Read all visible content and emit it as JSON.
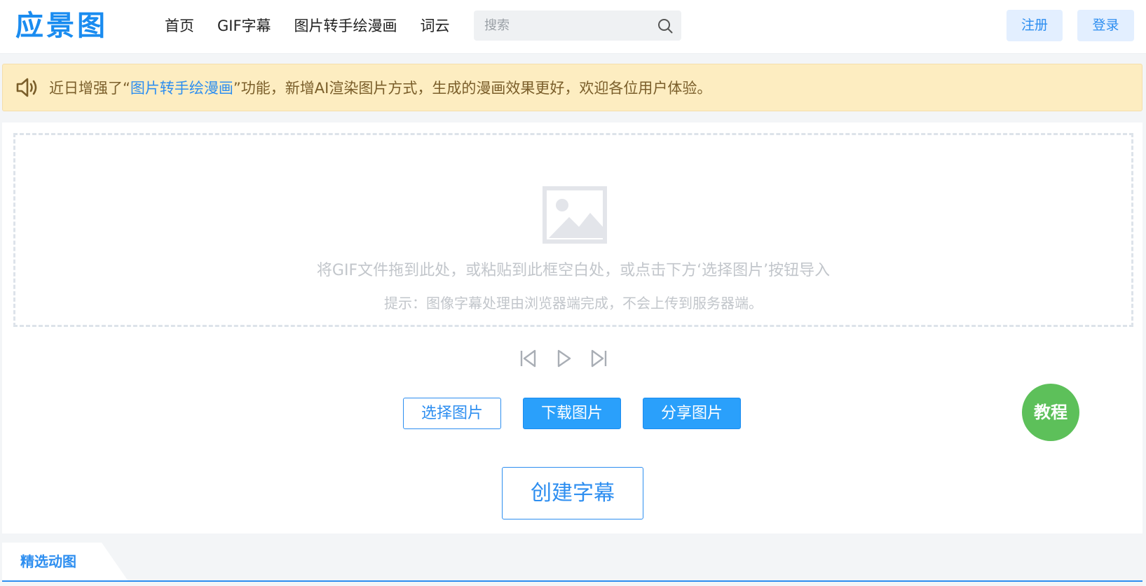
{
  "header": {
    "logo_text": "应景图",
    "nav": [
      {
        "label": "首页"
      },
      {
        "label": "GIF字幕"
      },
      {
        "label": "图片转手绘漫画"
      },
      {
        "label": "词云"
      }
    ],
    "search": {
      "placeholder": "搜索",
      "value": ""
    },
    "register_label": "注册",
    "login_label": "登录"
  },
  "notice": {
    "prefix": "近日增强了“",
    "link": "图片转手绘漫画",
    "suffix": "”功能，新增AI渲染图片方式，生成的漫画效果更好，欢迎各位用户体验。"
  },
  "dropzone": {
    "main_text": "将GIF文件拖到此处，或粘贴到此框空白处，或点击下方‘选择图片’按钮导入",
    "hint_text": "提示：图像字幕处理由浏览器端完成，不会上传到服务器端。"
  },
  "actions": {
    "select_label": "选择图片",
    "download_label": "下载图片",
    "share_label": "分享图片",
    "create_label": "创建字幕"
  },
  "tutorial_label": "教程",
  "tabs": [
    {
      "label": "精选动图",
      "active": true
    }
  ],
  "colors": {
    "accent": "#2d8ef0",
    "notice_bg": "#fdedc1",
    "tutorial_bg": "#5dc05a"
  },
  "icons": {
    "search": "search-icon",
    "notice": "speaker-icon",
    "placeholder": "image-icon",
    "prev": "skip-back-icon",
    "play": "play-icon",
    "next": "skip-forward-icon"
  }
}
